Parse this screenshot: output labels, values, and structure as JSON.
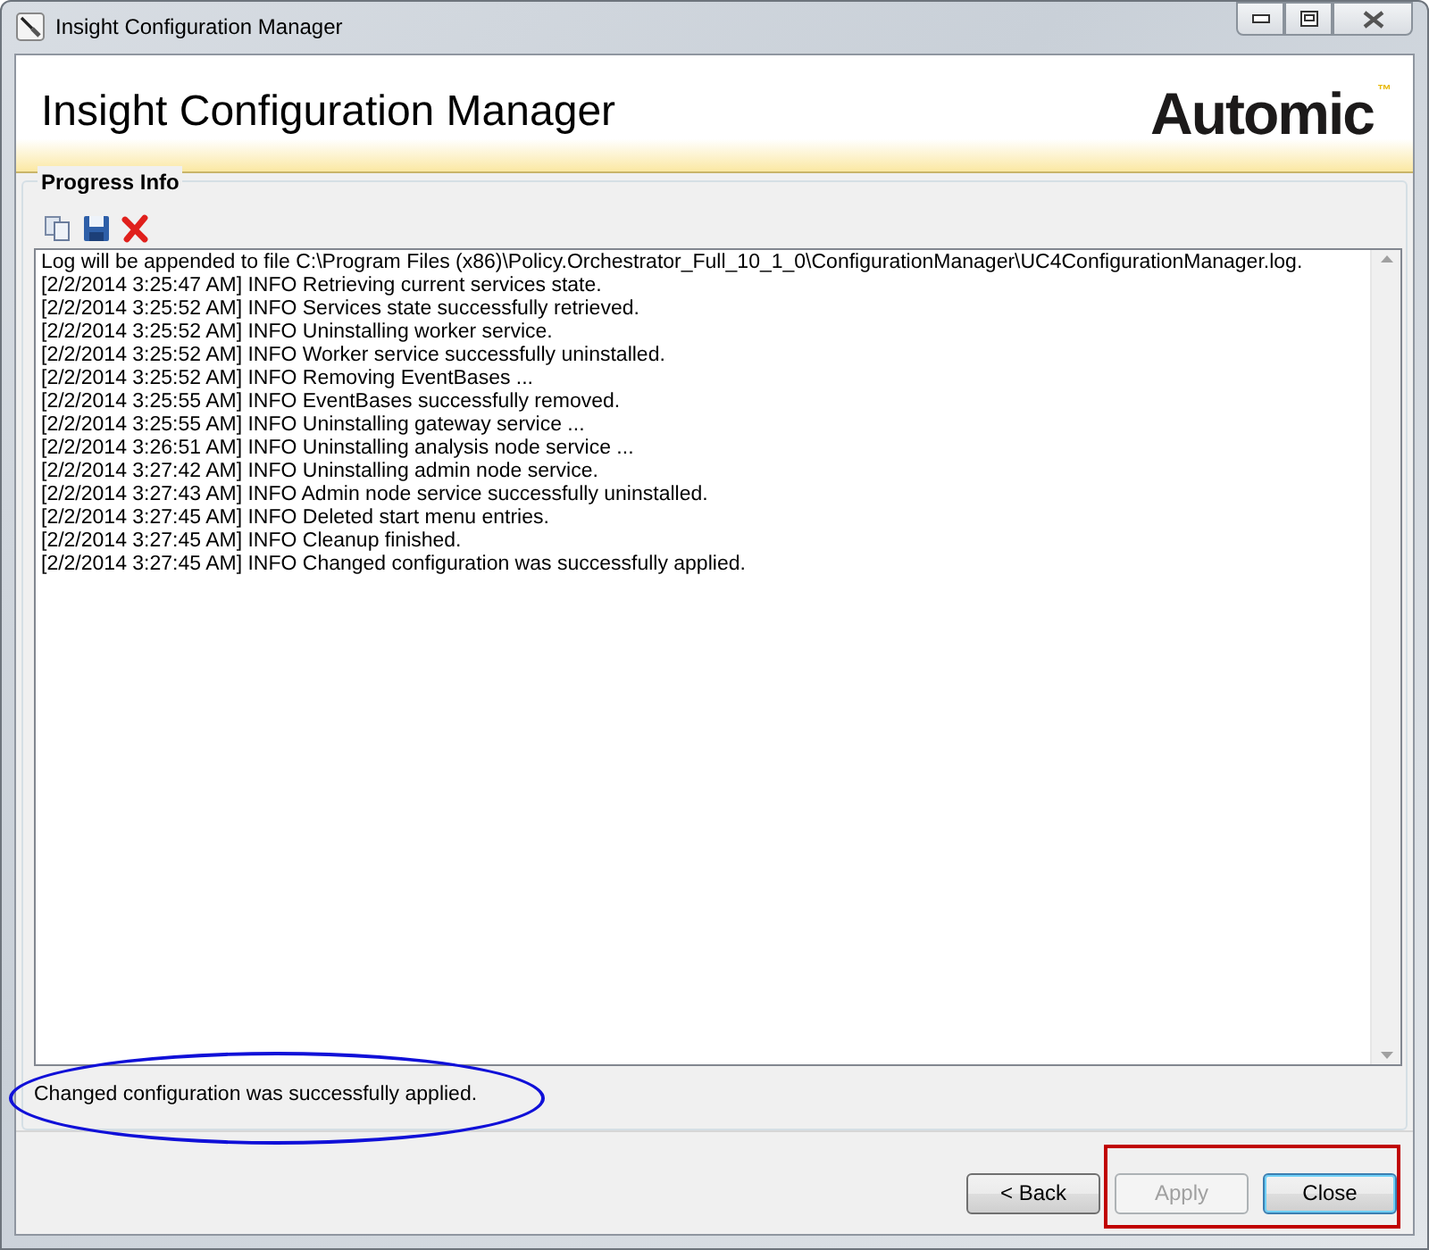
{
  "window": {
    "title": "Insight Configuration Manager"
  },
  "header": {
    "title": "Insight Configuration Manager",
    "logo": "Automic",
    "logo_mark": "™"
  },
  "group": {
    "title": "Progress Info"
  },
  "log": {
    "lines": [
      "Log will be appended to file C:\\Program Files (x86)\\Policy.Orchestrator_Full_10_1_0\\ConfigurationManager\\UC4ConfigurationManager.log.",
      "[2/2/2014 3:25:47 AM] INFO Retrieving current services state.",
      "[2/2/2014 3:25:52 AM] INFO Services state successfully retrieved.",
      "[2/2/2014 3:25:52 AM] INFO Uninstalling worker service.",
      "[2/2/2014 3:25:52 AM] INFO Worker service successfully uninstalled.",
      "[2/2/2014 3:25:52 AM] INFO Removing EventBases ...",
      "[2/2/2014 3:25:55 AM] INFO EventBases successfully removed.",
      "[2/2/2014 3:25:55 AM] INFO Uninstalling gateway service ...",
      "[2/2/2014 3:26:51 AM] INFO Uninstalling analysis node service ...",
      "[2/2/2014 3:27:42 AM] INFO Uninstalling admin node service.",
      "[2/2/2014 3:27:43 AM] INFO Admin node service successfully uninstalled.",
      "[2/2/2014 3:27:45 AM] INFO Deleted start menu entries.",
      "[2/2/2014 3:27:45 AM] INFO Cleanup finished.",
      "[2/2/2014 3:27:45 AM] INFO Changed configuration was successfully applied."
    ]
  },
  "status": "Changed configuration was successfully applied.",
  "buttons": [
    {
      "label": "< Back",
      "disabled": false,
      "focused": false
    },
    {
      "label": "Apply",
      "disabled": true,
      "focused": false
    },
    {
      "label": "Close",
      "disabled": false,
      "focused": true
    }
  ]
}
